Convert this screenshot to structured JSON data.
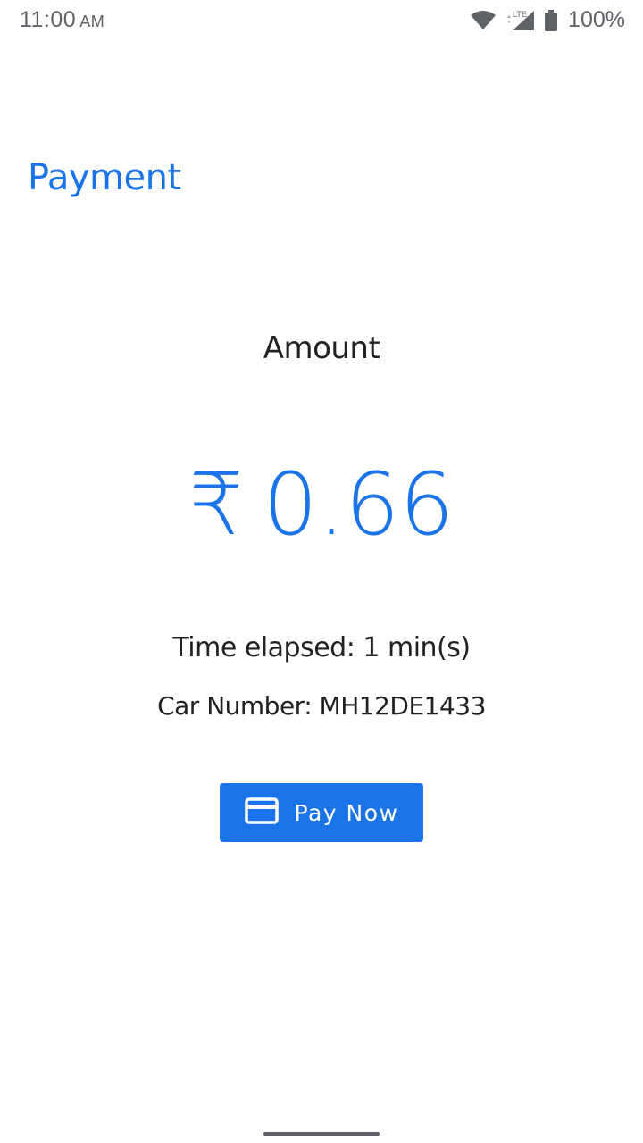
{
  "status_bar": {
    "time": "11:00",
    "ampm": "AM",
    "network_label": "LTE",
    "battery": "100%"
  },
  "title": "Payment",
  "amount_label": "Amount",
  "amount": {
    "currency": "₹",
    "value": "0.66"
  },
  "time_elapsed": "Time elapsed: 1 min(s)",
  "car_number": "Car Number: MH12DE1433",
  "pay_button": {
    "label": "Pay Now",
    "icon": "credit-card-icon"
  },
  "colors": {
    "accent": "#1a73e8",
    "text": "#202124",
    "status": "#5f6368"
  }
}
